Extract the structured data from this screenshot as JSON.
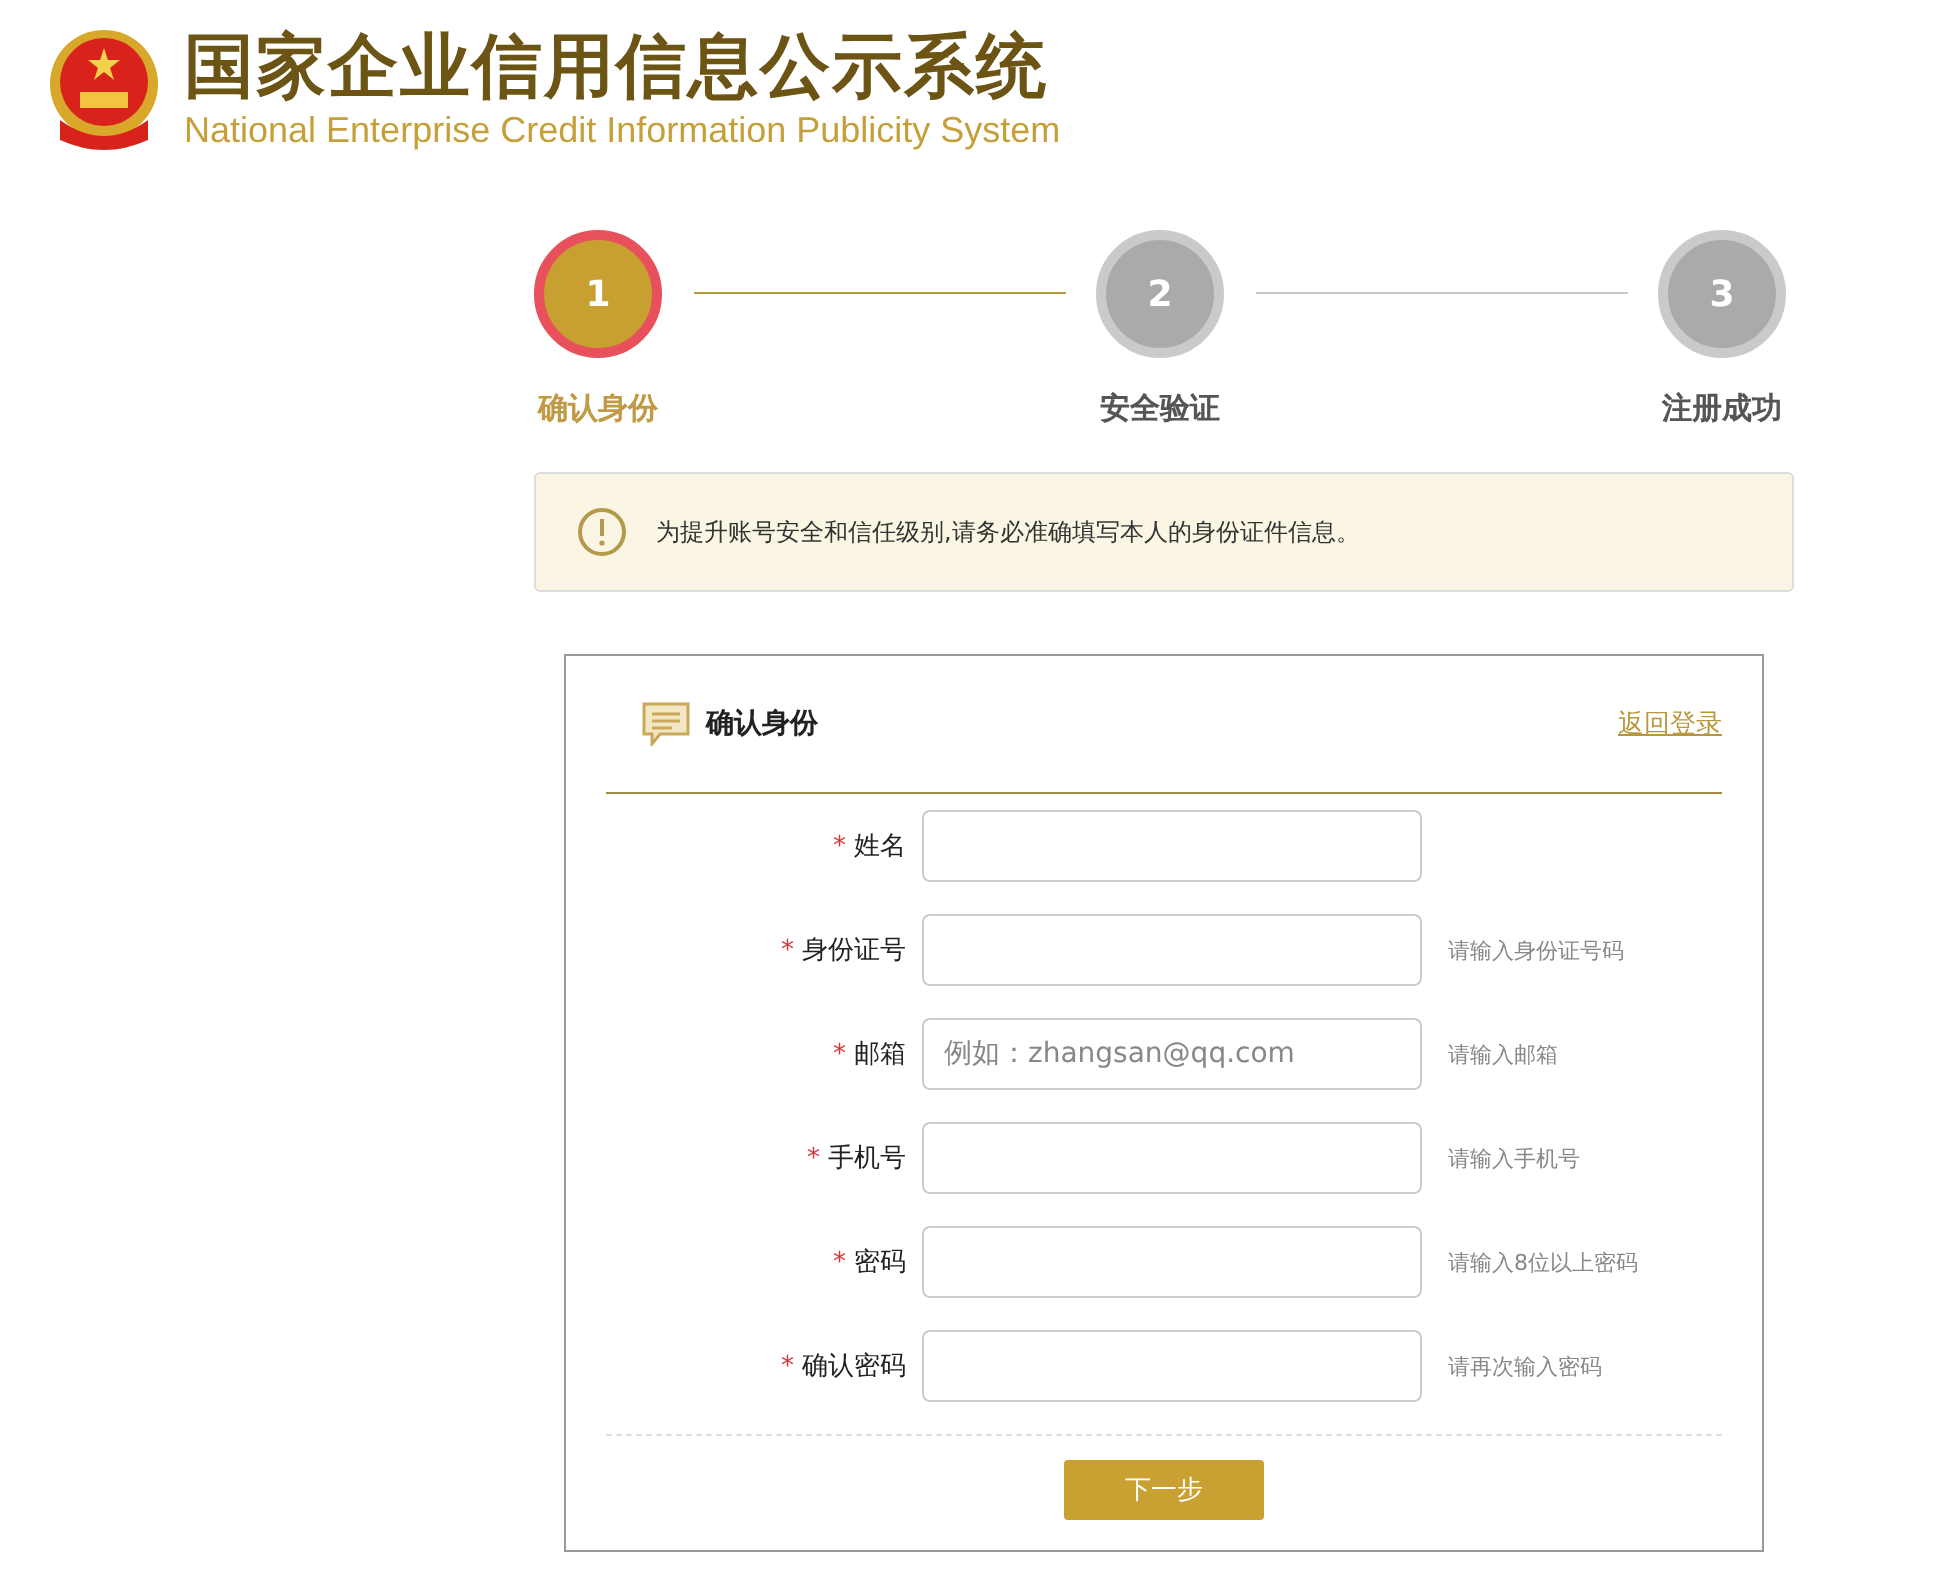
{
  "header": {
    "title": "国家企业信用信息公示系统",
    "subtitle": "National Enterprise Credit Information Publicity System"
  },
  "steps": [
    {
      "number": "1",
      "label": "确认身份",
      "selected": true
    },
    {
      "number": "2",
      "label": "安全验证",
      "selected": false
    },
    {
      "number": "3",
      "label": "注册成功",
      "selected": false
    }
  ],
  "notice": "为提升账号安全和信任级别,请务必准确填写本人的身份证件信息。",
  "form": {
    "title": "确认身份",
    "back_link": "返回登录",
    "fields": [
      {
        "required_mark": "*",
        "label": "姓名"
      },
      {
        "required_mark": "*",
        "label": "身份证号",
        "hint": "请输入身份证号码"
      },
      {
        "required_mark": "*",
        "label": "邮箱",
        "placeholder": "例如：zhangsan@qq.com",
        "hint": "请输入邮箱"
      },
      {
        "required_mark": "*",
        "label": "手机号",
        "hint": "请输入手机号"
      },
      {
        "required_mark": "*",
        "label": "密码",
        "hint": "请输入8位以上密码"
      },
      {
        "required_mark": "*",
        "label": "确认密码",
        "hint": "请再次输入密码"
      }
    ],
    "submit": "下一步"
  }
}
